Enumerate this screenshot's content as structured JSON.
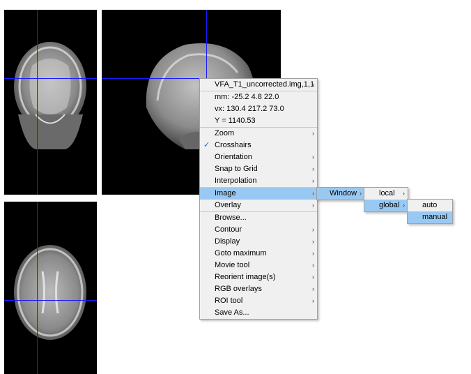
{
  "info": {
    "filename": "VFA_T1_uncorrected.img,1,1",
    "mm": "mm:  -25.2 4.8 22.0",
    "vx": "vx:  130.4 217.2 73.0",
    "y": "Y = 1140.53"
  },
  "menu": {
    "items": [
      {
        "label": "Zoom",
        "submenu": true
      },
      {
        "label": "Crosshairs",
        "checked": true
      },
      {
        "label": "Orientation",
        "submenu": true
      },
      {
        "label": "Snap to Grid",
        "submenu": true
      },
      {
        "label": "Interpolation",
        "submenu": true
      },
      {
        "label": "Image",
        "submenu": true,
        "selected": true
      },
      {
        "label": "Overlay",
        "submenu": true
      },
      {
        "label": "Browse..."
      },
      {
        "label": "Contour",
        "submenu": true
      },
      {
        "label": "Display",
        "submenu": true
      },
      {
        "label": "Goto maximum",
        "submenu": true
      },
      {
        "label": "Movie tool",
        "submenu": true
      },
      {
        "label": "Reorient image(s)",
        "submenu": true
      },
      {
        "label": "RGB overlays",
        "submenu": true
      },
      {
        "label": "ROI tool",
        "submenu": true
      },
      {
        "label": "Save As..."
      }
    ]
  },
  "image_submenu": {
    "window": "Window"
  },
  "window_submenu": {
    "local": "local",
    "global": "global"
  },
  "global_submenu": {
    "auto": "auto",
    "manual": "manual"
  },
  "colors": {
    "selection": "#99c9f2",
    "crosshair": "#1a1aff"
  }
}
